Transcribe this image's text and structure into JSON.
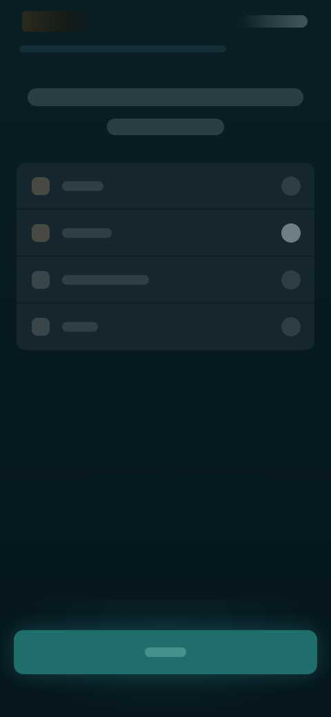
{
  "colors": {
    "background": "#071820",
    "card": "#16262e",
    "accent_button": "#1f6e6c"
  },
  "topbar": {
    "brand_icon": "app-logo-icon",
    "status_icon": "status-indicators-icon"
  },
  "options": {
    "items": [
      {
        "icon": "option-icon",
        "selected": false
      },
      {
        "icon": "option-icon",
        "selected": true
      },
      {
        "icon": "option-icon",
        "selected": false
      },
      {
        "icon": "option-icon",
        "selected": false
      }
    ]
  }
}
